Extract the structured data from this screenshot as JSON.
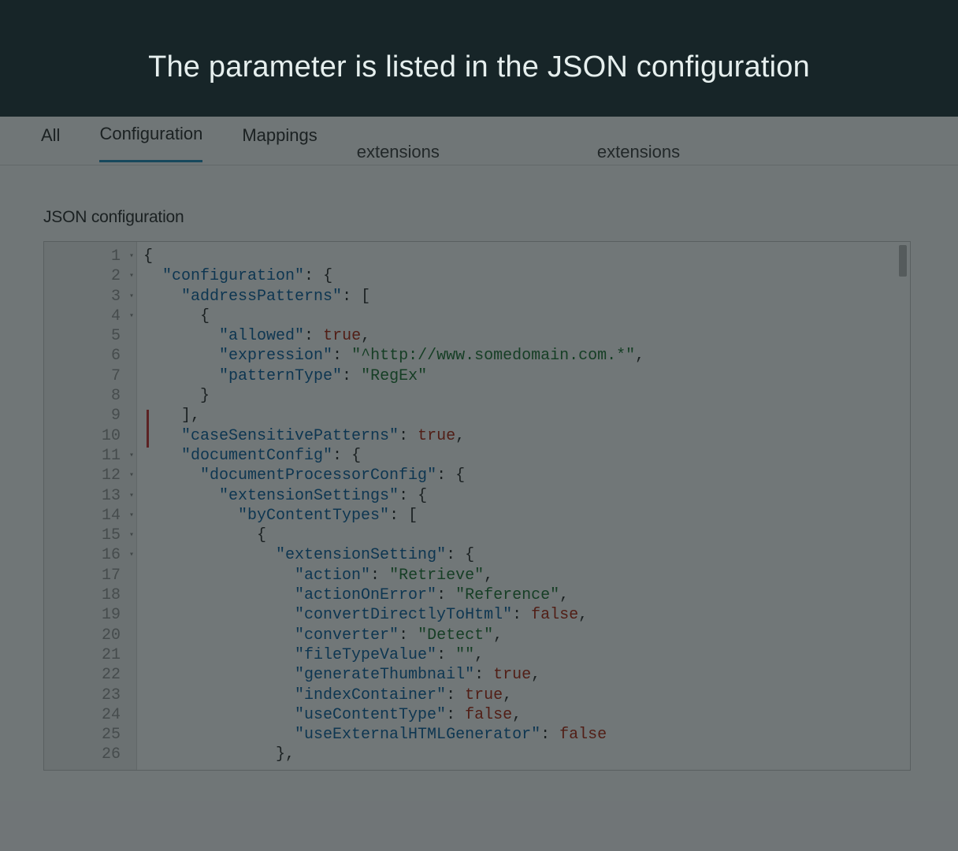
{
  "heading": "The parameter is listed in the JSON configuration",
  "tabs": {
    "all": "All",
    "configuration": "Configuration",
    "mappings": "Mappings",
    "ext1": "extensions",
    "ext2": "extensions"
  },
  "section_label": "JSON configuration",
  "code_lines": [
    {
      "n": 1,
      "fold": true,
      "tokens": [
        [
          "{",
          "punc"
        ]
      ]
    },
    {
      "n": 2,
      "fold": true,
      "tokens": [
        [
          "  ",
          ""
        ],
        [
          "\"configuration\"",
          "key"
        ],
        [
          ": ",
          "punc"
        ],
        [
          "{",
          "punc"
        ]
      ]
    },
    {
      "n": 3,
      "fold": true,
      "tokens": [
        [
          "    ",
          ""
        ],
        [
          "\"addressPatterns\"",
          "key"
        ],
        [
          ": ",
          "punc"
        ],
        [
          "[",
          "punc"
        ]
      ]
    },
    {
      "n": 4,
      "fold": true,
      "tokens": [
        [
          "      ",
          ""
        ],
        [
          "{",
          "punc"
        ]
      ]
    },
    {
      "n": 5,
      "fold": false,
      "tokens": [
        [
          "        ",
          ""
        ],
        [
          "\"allowed\"",
          "key"
        ],
        [
          ": ",
          "punc"
        ],
        [
          "true",
          "bool"
        ],
        [
          ",",
          "punc"
        ]
      ]
    },
    {
      "n": 6,
      "fold": false,
      "tokens": [
        [
          "        ",
          ""
        ],
        [
          "\"expression\"",
          "key"
        ],
        [
          ": ",
          "punc"
        ],
        [
          "\"^http://www.somedomain.com.*\"",
          "str"
        ],
        [
          ",",
          "punc"
        ]
      ]
    },
    {
      "n": 7,
      "fold": false,
      "tokens": [
        [
          "        ",
          ""
        ],
        [
          "\"patternType\"",
          "key"
        ],
        [
          ": ",
          "punc"
        ],
        [
          "\"RegEx\"",
          "str"
        ]
      ]
    },
    {
      "n": 8,
      "fold": false,
      "tokens": [
        [
          "      ",
          ""
        ],
        [
          "}",
          "punc"
        ]
      ]
    },
    {
      "n": 9,
      "fold": false,
      "tokens": [
        [
          "    ",
          ""
        ],
        [
          "],",
          "punc"
        ]
      ]
    },
    {
      "n": 10,
      "fold": false,
      "tokens": [
        [
          "    ",
          ""
        ],
        [
          "\"caseSensitivePatterns\"",
          "key"
        ],
        [
          ": ",
          "punc"
        ],
        [
          "true",
          "bool"
        ],
        [
          ",",
          "punc"
        ]
      ]
    },
    {
      "n": 11,
      "fold": true,
      "tokens": [
        [
          "    ",
          ""
        ],
        [
          "\"documentConfig\"",
          "key"
        ],
        [
          ": ",
          "punc"
        ],
        [
          "{",
          "punc"
        ]
      ]
    },
    {
      "n": 12,
      "fold": true,
      "tokens": [
        [
          "      ",
          ""
        ],
        [
          "\"documentProcessorConfig\"",
          "key"
        ],
        [
          ": ",
          "punc"
        ],
        [
          "{",
          "punc"
        ]
      ]
    },
    {
      "n": 13,
      "fold": true,
      "tokens": [
        [
          "        ",
          ""
        ],
        [
          "\"extensionSettings\"",
          "key"
        ],
        [
          ": ",
          "punc"
        ],
        [
          "{",
          "punc"
        ]
      ]
    },
    {
      "n": 14,
      "fold": true,
      "tokens": [
        [
          "          ",
          ""
        ],
        [
          "\"byContentTypes\"",
          "key"
        ],
        [
          ": ",
          "punc"
        ],
        [
          "[",
          "punc"
        ]
      ]
    },
    {
      "n": 15,
      "fold": true,
      "tokens": [
        [
          "            ",
          ""
        ],
        [
          "{",
          "punc"
        ]
      ]
    },
    {
      "n": 16,
      "fold": true,
      "tokens": [
        [
          "              ",
          ""
        ],
        [
          "\"extensionSetting\"",
          "key"
        ],
        [
          ": ",
          "punc"
        ],
        [
          "{",
          "punc"
        ]
      ]
    },
    {
      "n": 17,
      "fold": false,
      "tokens": [
        [
          "                ",
          ""
        ],
        [
          "\"action\"",
          "key"
        ],
        [
          ": ",
          "punc"
        ],
        [
          "\"Retrieve\"",
          "str"
        ],
        [
          ",",
          "punc"
        ]
      ]
    },
    {
      "n": 18,
      "fold": false,
      "tokens": [
        [
          "                ",
          ""
        ],
        [
          "\"actionOnError\"",
          "key"
        ],
        [
          ": ",
          "punc"
        ],
        [
          "\"Reference\"",
          "str"
        ],
        [
          ",",
          "punc"
        ]
      ]
    },
    {
      "n": 19,
      "fold": false,
      "tokens": [
        [
          "                ",
          ""
        ],
        [
          "\"convertDirectlyToHtml\"",
          "key"
        ],
        [
          ": ",
          "punc"
        ],
        [
          "false",
          "bool"
        ],
        [
          ",",
          "punc"
        ]
      ]
    },
    {
      "n": 20,
      "fold": false,
      "tokens": [
        [
          "                ",
          ""
        ],
        [
          "\"converter\"",
          "key"
        ],
        [
          ": ",
          "punc"
        ],
        [
          "\"Detect\"",
          "str"
        ],
        [
          ",",
          "punc"
        ]
      ]
    },
    {
      "n": 21,
      "fold": false,
      "tokens": [
        [
          "                ",
          ""
        ],
        [
          "\"fileTypeValue\"",
          "key"
        ],
        [
          ": ",
          "punc"
        ],
        [
          "\"\"",
          "str"
        ],
        [
          ",",
          "punc"
        ]
      ]
    },
    {
      "n": 22,
      "fold": false,
      "tokens": [
        [
          "                ",
          ""
        ],
        [
          "\"generateThumbnail\"",
          "key"
        ],
        [
          ": ",
          "punc"
        ],
        [
          "true",
          "bool"
        ],
        [
          ",",
          "punc"
        ]
      ]
    },
    {
      "n": 23,
      "fold": false,
      "tokens": [
        [
          "                ",
          ""
        ],
        [
          "\"indexContainer\"",
          "key"
        ],
        [
          ": ",
          "punc"
        ],
        [
          "true",
          "bool"
        ],
        [
          ",",
          "punc"
        ]
      ]
    },
    {
      "n": 24,
      "fold": false,
      "tokens": [
        [
          "                ",
          ""
        ],
        [
          "\"useContentType\"",
          "key"
        ],
        [
          ": ",
          "punc"
        ],
        [
          "false",
          "bool"
        ],
        [
          ",",
          "punc"
        ]
      ]
    },
    {
      "n": 25,
      "fold": false,
      "tokens": [
        [
          "                ",
          ""
        ],
        [
          "\"useExternalHTMLGenerator\"",
          "key"
        ],
        [
          ": ",
          "punc"
        ],
        [
          "false",
          "bool"
        ]
      ]
    },
    {
      "n": 26,
      "fold": false,
      "tokens": [
        [
          "              ",
          ""
        ],
        [
          "},",
          "punc"
        ]
      ]
    }
  ]
}
